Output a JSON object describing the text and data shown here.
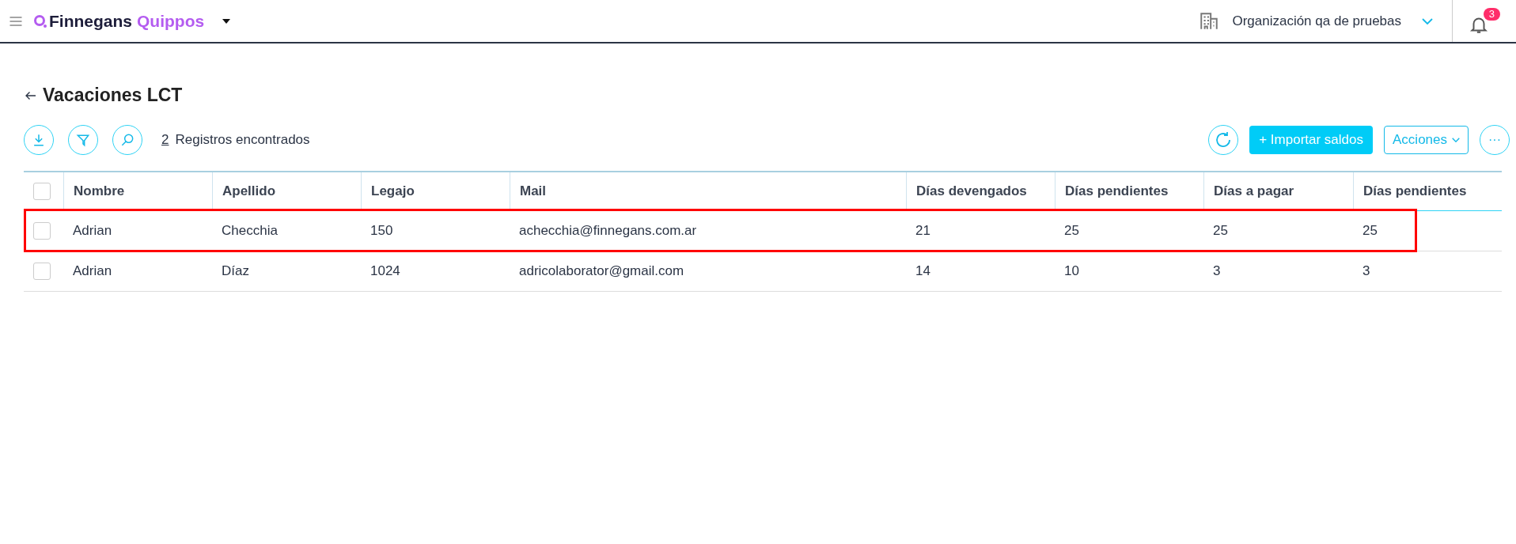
{
  "header": {
    "brand_primary": "Finnegans",
    "brand_secondary": "Quippos",
    "organization": "Organización qa de pruebas",
    "notifications": "3"
  },
  "page": {
    "title": "Vacaciones LCT",
    "count": "2",
    "count_label": "Registros encontrados"
  },
  "actions": {
    "import": "+ Importar saldos",
    "menu": "Acciones",
    "more": "···"
  },
  "table": {
    "all_checked": false,
    "columns": [
      "Nombre",
      "Apellido",
      "Legajo",
      "Mail",
      "Días devengados",
      "Días pendientes",
      "Días a pagar",
      "Días pendientes"
    ],
    "rows": [
      {
        "checked": false,
        "highlighted": true,
        "cells": [
          "Adrian",
          "Checchia",
          "150",
          "achecchia@finnegans.com.ar",
          "21",
          "25",
          "25",
          "25"
        ]
      },
      {
        "checked": false,
        "highlighted": false,
        "cells": [
          "Adrian",
          "Díaz",
          "1024",
          "adricolaborator@gmail.com",
          "14",
          "10",
          "3",
          "3"
        ]
      }
    ]
  }
}
